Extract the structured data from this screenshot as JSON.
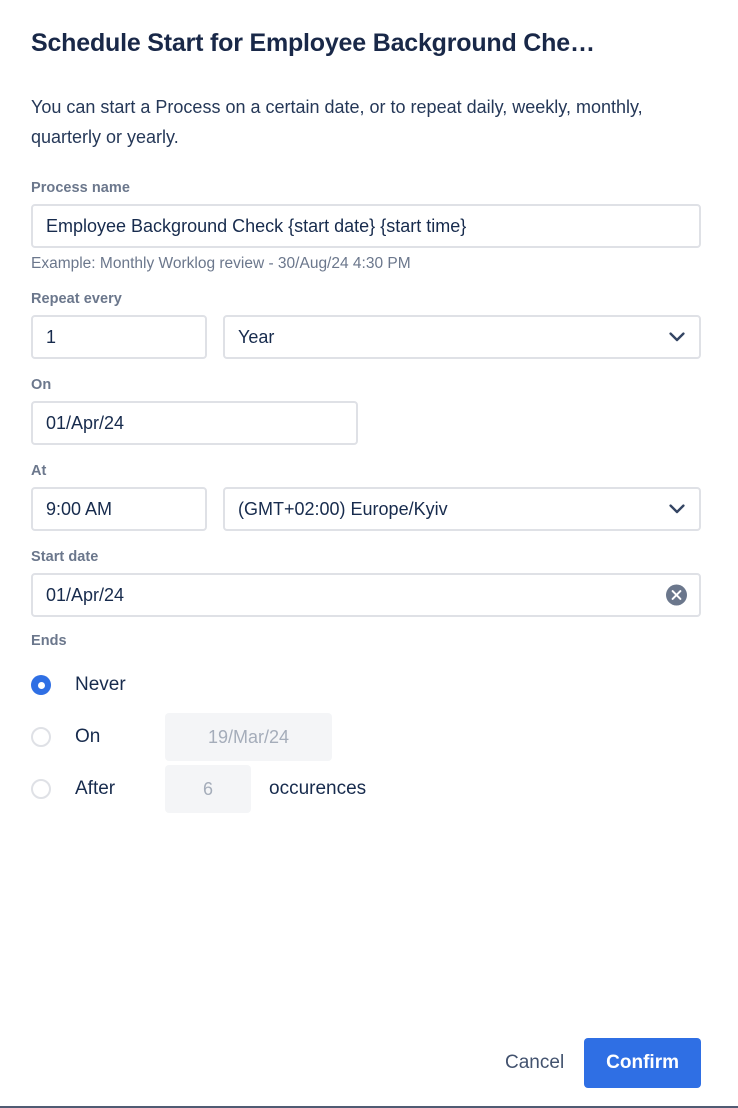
{
  "dialog": {
    "title": "Schedule Start for Employee Background Che…",
    "description": "You can start a Process on a certain date, or to repeat daily, weekly, monthly, quarterly or yearly."
  },
  "process_name": {
    "label": "Process name",
    "value": "Employee Background Check {start date} {start time}",
    "help": "Example: Monthly Worklog review - 30/Aug/24 4:30 PM"
  },
  "repeat": {
    "label": "Repeat every",
    "interval_value": "1",
    "unit_value": "Year"
  },
  "on_section": {
    "label": "On",
    "value": "01/Apr/24"
  },
  "at_section": {
    "label": "At",
    "time_value": "9:00 AM",
    "timezone_value": "(GMT+02:00) Europe/Kyiv"
  },
  "start_date": {
    "label": "Start date",
    "value": "01/Apr/24",
    "clear_icon": "clear-circle-icon"
  },
  "ends": {
    "label": "Ends",
    "options": [
      {
        "label": "Never",
        "selected": true
      },
      {
        "label": "On",
        "selected": false,
        "input_value": "19/Mar/24"
      },
      {
        "label": "After",
        "selected": false,
        "input_value": "6",
        "suffix": "occurences"
      }
    ]
  },
  "footer": {
    "cancel_label": "Cancel",
    "confirm_label": "Confirm"
  },
  "colors": {
    "accent": "#2f6fe4",
    "title": "#192848",
    "label": "#6b778c",
    "border": "#dfe1e6",
    "disabled_bg": "#f4f5f7"
  }
}
